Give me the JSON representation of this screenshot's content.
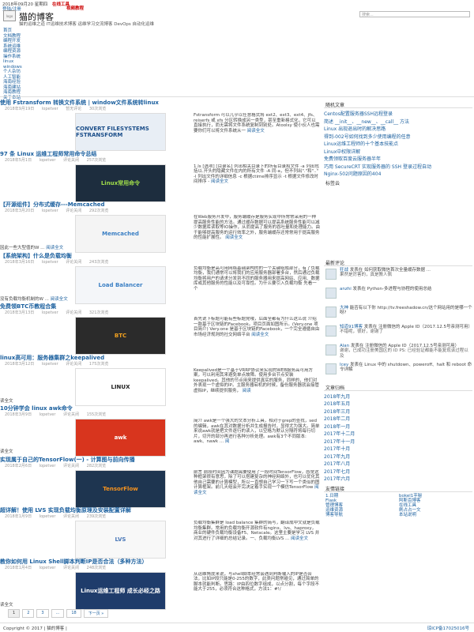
{
  "topbar": {
    "date": "2018年09月20 星期四",
    "red1": "在线工具",
    "red2": "视频教程",
    "login": "登陆/注册"
  },
  "search": {
    "placeholder": "搜索..."
  },
  "site": {
    "logo_alt": "logo",
    "title": "猫的博客",
    "tagline": "猫的运维之道 IT运维技术博客 运维学习交流博客 DevOps 自动化运维"
  },
  "menu": [
    "首页",
    "文档教程",
    "编程开发",
    "系统运维",
    "编程资源",
    "操作系统",
    "linux",
    "windows",
    "个人杂坊",
    "人工智能",
    "海南经验",
    "海南建站",
    "海南教程",
    "关于本站"
  ],
  "posts": [
    {
      "title": "使用 Fstransform 转换文件系统 | window文件系统转linux",
      "date": "2018年9月19日",
      "author": "lopetver",
      "comments": "暂无评论",
      "views": "30次浏览",
      "thumb": "CONVERT FILESYSTEMS FSTRANSFORM",
      "excerpt": "Fstransform 可以几乎以任意格式将 ext2、ext3、ext4、jfs、reiserfs 或 xfs 分区转换成另一类型，甚至重新格式化，它可以直接执行，而无需将文件系统复制到别处。Atoolsy 使小伙人也需要你们可以将文件系统从一",
      "more": "阅读全文"
    },
    {
      "title": "97 条 Linux 运维工程师常用命令总结",
      "date": "2018年5月1日",
      "author": "lopetver",
      "comments": "评论关闭",
      "views": "257次浏览",
      "thumb": "Linux常用命令",
      "excerpt": "1.ls [选项] [目录名] 列出相关目录下的所有目录和文件 -a 列出包括以.开头的隐藏文件在内的所有文件 -A 同-a，但不列出\".\"和\"..\" -l 列出文件的详细信息 -c 根据ctime排序显示 -t 根据文件修改时间排序 -",
      "more": "阅读全文"
    },
    {
      "title": "【开源组件】分布式缓存---Memcached",
      "date": "2018年3月20日",
      "author": "lopetver",
      "comments": "评论关闭",
      "views": "292次浏览",
      "thumb": "Memcached",
      "excerpt": "在Web服务开发中，服务端缓存是服务实现中所常常采用的一种提高服务性能的方法。通过缓存数据可以提高系统服务性能可以减少数据库读取等IO操作，从而提高了服务的吞吐量和处理能力。由于能够提高服务的运行效率之外，服务端缓存还常常用于提高服务的性能扩展性。",
      "more": "阅读全文",
      "tail": "因此一些大型值的W ...",
      "tailmore": "阅读全文"
    },
    {
      "title": "【系统架构】什么是负载均衡",
      "date": "2018年3月16日",
      "author": "lopetver",
      "comments": "评论关闭",
      "views": "243次浏览",
      "thumb": "Load Balancer",
      "excerpt": "负载均衡是高可用网络基础架构的的一个关键组成部分，有了负载均衡，我们通常可以将我们的应用服务器部署多台，然后通过负载均衡将用户的请求分发到不同的服务器用来提高网站、应用、数据库或其他服务的性能以及可靠性。为什么要引入负载均衡 先看一个",
      "more": "",
      "tail": "没有负载均衡机制的W ...",
      "tailmore": "阅读全文"
    },
    {
      "title": "免费领BTC币教程合集",
      "date": "2018年3月13日",
      "author": "lopetver",
      "comments": "评论关闭",
      "views": "321次浏览",
      "thumb": "BTC",
      "excerpt": "首先说下标题可能有些标题党哦，后面全都有为什么这么说 介绍一款基于区块链的Facebook。项目页面如图所示。(Very.one 项目简介) Very.one 是基于区块链的Facebook，一个完全遵循自由市场经济规则的社交网络平台",
      "more": "阅读全文"
    },
    {
      "title": "linux高可用：服务器集群之keepalived",
      "date": "2018年3月12日",
      "author": "lopetver",
      "comments": "评论关闭",
      "views": "175次浏览",
      "thumb": "LINUX",
      "excerpt": "Keepalived是一个基于VRRP协议来实现的WEB服务高可用方案，可以利用其来避免单点故障。使用多台节点安装keepalived。其他的节点用来提供真实的服务，同样的，他们对外表现一个虚拟的IP。主服务器宕机的时候，备份服务器就会接管虚拟IP，继续提供服务，",
      "more": "阅读",
      "tail": "读全文",
      "tailmore": ""
    },
    {
      "title": "10分钟学会 linux awk命令",
      "date": "2018年3月9日",
      "author": "lopetver",
      "comments": "评论关闭",
      "views": "155次浏览",
      "thumb": "awk",
      "excerpt": "简介 awk是一个强大的文本分析工具，相对于grep的查找，sed的编辑，awk在其对数据分析并生成报告时，显得尤为强大。简单来说awk就是把文件逐行的读入，以空格为默认分隔符将每行切片，切开的部分再进行各种分析处理。awk有3个不同版本: awk、nawk ...",
      "more": "阅",
      "tail": "读全文",
      "tailmore": ""
    },
    {
      "title": "实现属于自己的TensorFlow(一) - 计算图与前向传播",
      "date": "2018年2月6日",
      "author": "lopetver",
      "comments": "评论关闭",
      "views": "282次浏览",
      "thumb": "TensorFlow",
      "excerpt": "前言 前段时间因为课题需要使用了一段时间TensorFlow，感觉这种框架很有意思，除了可以搭建复杂的神经网络外，也可以优化其他自己需要的计算模型，所以一直想自己学习一下写一个类似的图计算框架。前几天组会开完决定着手实现一个模仿TensorFlow",
      "more": "阅读全文"
    },
    {
      "title": "超详解！使用 LVS 实现负载均衡原理及安装配置详解",
      "date": "2018年1月9日",
      "author": "lopetver",
      "comments": "评论关闭",
      "views": "239次浏览",
      "thumb": "LVS",
      "excerpt": "负载均衡集群是 load balance 集群的简写，翻译成中文就是负载均衡集群。常用的负载均衡开源软件有nginx、lvs、haproxy，商业的硬件负载均衡设备F5、Netscale。这里主要是学习 LVS 并对其进行了详细的总结记录。一、负载均衡LVS ...",
      "more": "阅读全文"
    },
    {
      "title": "教你如何用 Linux Shell脚本判断IP是否合法（多种方法）",
      "date": "2018年1月4日",
      "author": "lopetver",
      "comments": "评论关闭",
      "views": "248次浏览",
      "thumb": "Linux运维工程师 成长必经之路",
      "excerpt": "从运维角度来说，写shell脚本经常会遇到判断输入的IP是否合法，比如IP段只能是0-255的数字，此类问题常碰见，通过简单的脚本就能判断。思路：IP由四位数字组成，以点分割，每个字段不能大于255，必须符合这种格式，方法1：#!/",
      "more": "",
      "tail": "读全文",
      "tailmore": ""
    }
  ],
  "pager": [
    "1",
    "2",
    "3",
    "...",
    "18",
    "下一页 »"
  ],
  "footer": {
    "copyright": "Copyright © 2017 | 猫的博客 |",
    "icp": "琼ICP备17025016号"
  },
  "sidebar": {
    "recent_title": "随机文章",
    "recent": [
      "Centos配置服务器SSH远程登录",
      "简述 __init__、__new__、__call__ 方法",
      "Linux 出现退出时的解决思路",
      "得到-002号如何找到多少使用编程的任意",
      "Linux运维工程师的十个基本技能点",
      "Linux中权限详解",
      "免费领取百度云服务器半年",
      "巧用 SecureCRT 实现服务器的 SSH 登录过程自动",
      "Nginx-502问题原因的404"
    ],
    "tags_title": "标签云",
    "comments_title": "最新评论",
    "comments": [
      {
        "who": "狂战",
        "text": "发表在 如何获取微信首次全量缓存数据 ...",
        "extra": "果然是厉害的，真是教人佩"
      },
      {
        "who": "anzhi",
        "text": "发表在 Python-多进程与协程的使用总结",
        "extra": ""
      },
      {
        "who": "大神",
        "text": "能否有以下你 http://tv.freeshadow.cn/这个网站用的是哪一个呀?",
        "extra": ""
      },
      {
        "who": "知道91博客",
        "text": "发表在 注册微信的 Apple ID（2017.12.5号亲测可用）",
        "extra": "不错呢，很好，谢谢了"
      },
      {
        "who": "Alan",
        "text": "发表在 注册微信的 Apple ID（2017.12.5号亲测可用）",
        "extra": "谢谢，已成功注册美国区的 ID PS: 已经验证都能不能复现该过程以及"
      },
      {
        "who": "Icey",
        "text": "发表在 Linux 中的 shutdown、poweroff、halt 和 reboot 命令详解",
        "extra": ""
      }
    ],
    "archive_title": "文章归档",
    "archive": [
      "2018年九月",
      "2018年五月",
      "2018年三月",
      "2018年二月",
      "2018年一月",
      "2017年十二月",
      "2017年十一月",
      "2017年十月",
      "2017年九月",
      "2017年八月",
      "2017年七月",
      "2017年六月"
    ],
    "links_title": "友情链接",
    "links": [
      "1.日期",
      "Flask",
      "管理博客",
      "运维资源",
      "博客导航",
      "bokel1芋秘",
      "阿斯百博客",
      "在线工具",
      "刷占占一文",
      "本站说明"
    ]
  },
  "colors": {
    "link": "#1a5f9e",
    "accent_red": "#cc0000"
  }
}
